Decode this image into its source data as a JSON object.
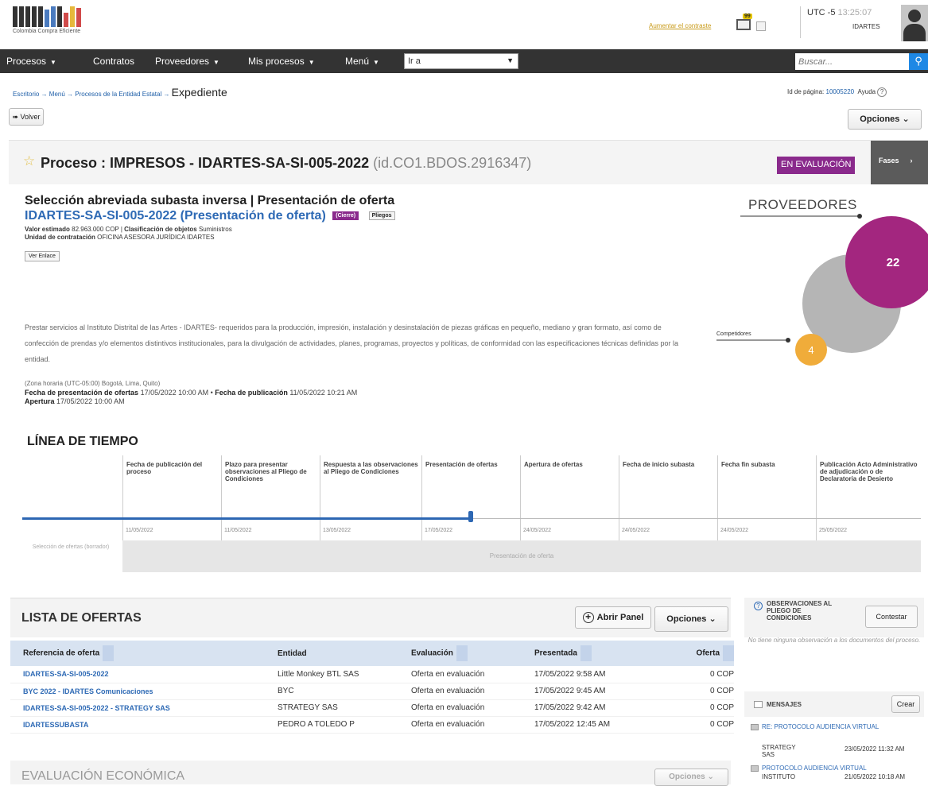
{
  "header": {
    "logo_caption": "Colombia Compra Eficiente",
    "access_link": "Aumentar el contraste",
    "msg_count": "99",
    "timezone": "UTC -5",
    "time": "13:25:07",
    "org": "IDARTES"
  },
  "nav": {
    "items": [
      "Procesos",
      "Contratos",
      "Proveedores",
      "Mis procesos",
      "Menú"
    ],
    "goto": "Ir a",
    "search_placeholder": "Buscar..."
  },
  "breadcrumb": {
    "items": [
      "Escritorio",
      "Menú",
      "Procesos de la Entidad Estatal"
    ],
    "current": "Expediente",
    "page_id_label": "Id de página:",
    "page_id": "10005220",
    "help": "Ayuda"
  },
  "actions": {
    "back": "Volver",
    "options": "Opciones"
  },
  "process": {
    "title": "Proceso : IMPRESOS - IDARTES-SA-SI-005-2022",
    "id": "(id.CO1.BDOS.2916347)",
    "status": "EN EVALUACIÓN",
    "phases": "Fases",
    "type": "Selección abreviada subasta inversa | Presentación de oferta",
    "ref": "IDARTES-SA-SI-005-2022 (Presentación de oferta)",
    "tag_cierre": "(Cierre)",
    "tag_pliegos": "Pliegos",
    "value_label": "Valor estimado",
    "value": "82.963.000 COP",
    "class_label": "Clasificación de objetos",
    "class_value": "Suministros",
    "unit_label": "Unidad de contratación",
    "unit_value": "OFICINA ASESORA JURÍDICA IDARTES",
    "link_btn": "Ver Enlace",
    "description": "Prestar servicios al Instituto Distrital de las Artes - IDARTES- requeridos para la producción, impresión, instalación y desinstalación de piezas gráficas en pequeño, mediano y gran formato, así como de confección de prendas y/o elementos distintivos institucionales, para la divulgación de actividades, planes, programas, proyectos y políticas, de conformidad con las especificaciones técnicas definidas por la entidad.",
    "timezone": "(Zona horaria (UTC-05:00) Bogotá, Lima, Quito)",
    "offer_date_label": "Fecha de presentación de ofertas",
    "offer_date": "17/05/2022 10:00 AM",
    "pub_date_label": "Fecha de publicación",
    "pub_date": "11/05/2022 10:21 AM",
    "opening_label": "Apertura",
    "opening": "17/05/2022 10:00 AM"
  },
  "providers": {
    "title": "PROVEEDORES",
    "count": "22",
    "competitors_label": "Competidores",
    "competitors": "4"
  },
  "timeline": {
    "title": "LÍNEA DE TIEMPO",
    "steps": [
      {
        "label": "Fecha de publicación del proceso",
        "date": "11/05/2022"
      },
      {
        "label": "Plazo para presentar observaciones al Pliego de Condiciones",
        "date": "11/05/2022"
      },
      {
        "label": "Respuesta a las observaciones al Pliego de Condiciones",
        "date": "13/05/2022"
      },
      {
        "label": "Presentación de ofertas",
        "date": "17/05/2022"
      },
      {
        "label": "Apertura de ofertas",
        "date": "24/05/2022"
      },
      {
        "label": "Fecha de inicio subasta",
        "date": "24/05/2022"
      },
      {
        "label": "Fecha fin subasta",
        "date": "24/05/2022"
      },
      {
        "label": "Publicación Acto Administrativo de adjudicación o de Declaratoria de Desierto",
        "date": "25/05/2022"
      }
    ],
    "progress": 0.5,
    "phase_label": "Selección de ofertas (borrador)",
    "phase_bar": "Presentación de oferta"
  },
  "offers": {
    "title": "LISTA DE OFERTAS",
    "open_panel": "Abrir Panel",
    "options": "Opciones",
    "columns": [
      "Referencia de oferta",
      "Entidad",
      "Evaluación",
      "Presentada",
      "Oferta"
    ],
    "rows": [
      [
        "IDARTES-SA-SI-005-2022",
        "Little Monkey BTL SAS",
        "Oferta en evaluación",
        "17/05/2022 9:58 AM",
        "0 COP"
      ],
      [
        "BYC 2022 - IDARTES Comunicaciones",
        "BYC",
        "Oferta en evaluación",
        "17/05/2022 9:45 AM",
        "0 COP"
      ],
      [
        "IDARTES-SA-SI-005-2022 - STRATEGY SAS",
        "STRATEGY SAS",
        "Oferta en evaluación",
        "17/05/2022 9:42 AM",
        "0 COP"
      ],
      [
        "IDARTESSUBASTA",
        "PEDRO A TOLEDO P",
        "Oferta en evaluación",
        "17/05/2022 12:45 AM",
        "0 COP"
      ]
    ],
    "eval_title": "EVALUACIÓN ECONÓMICA"
  },
  "sidebar": {
    "obs_title": "OBSERVACIONES AL PLIEGO DE CONDICIONES",
    "answer": "Contestar",
    "obs_empty": "No tiene ninguna observación a los documentos del proceso.",
    "msg_title": "MENSAJES",
    "create": "Crear",
    "messages": [
      {
        "subject": "RE: PROTOCOLO AUDIENCIA VIRTUAL",
        "from": "STRATEGY SAS",
        "date": "23/05/2022 11:32 AM"
      },
      {
        "subject": "PROTOCOLO AUDIENCIA VIRTUAL",
        "from": "INSTITUTO",
        "date": "21/05/2022 10:18 AM"
      }
    ]
  },
  "colors": {
    "accent": "#8a2a8c",
    "link": "#2e6ab5",
    "nav": "#333333",
    "bubble_main": "#a3267f",
    "bubble_gray": "#b5b5b5",
    "bubble_orange": "#f0ac3a"
  }
}
